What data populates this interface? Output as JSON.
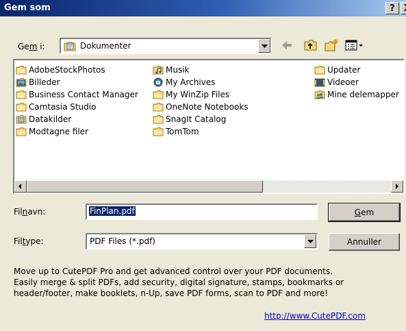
{
  "window": {
    "title": "Gem som",
    "help_label": "?",
    "close_label": "X"
  },
  "location": {
    "label_pre": "Ge",
    "label_accel": "m",
    "label_post": " i:",
    "value": "Dokumenter"
  },
  "files": [
    {
      "name": "AdobeStockPhotos",
      "icon": "folder-icon"
    },
    {
      "name": "Billeder",
      "icon": "pictures-folder-icon"
    },
    {
      "name": "Business Contact Manager",
      "icon": "folder-icon"
    },
    {
      "name": "Camtasia Studio",
      "icon": "folder-icon"
    },
    {
      "name": "Datakilder",
      "icon": "datasource-folder-icon"
    },
    {
      "name": "Modtagne filer",
      "icon": "folder-icon"
    },
    {
      "name": "Musik",
      "icon": "music-folder-icon"
    },
    {
      "name": "My Archives",
      "icon": "archive-icon"
    },
    {
      "name": "My WinZip Files",
      "icon": "folder-icon"
    },
    {
      "name": "OneNote Notebooks",
      "icon": "folder-icon"
    },
    {
      "name": "SnagIt Catalog",
      "icon": "folder-icon"
    },
    {
      "name": "TomTom",
      "icon": "folder-icon"
    },
    {
      "name": "Updater",
      "icon": "folder-icon"
    },
    {
      "name": "Videoer",
      "icon": "video-folder-icon"
    },
    {
      "name": "Mine delemapper",
      "icon": "shared-folder-icon"
    }
  ],
  "filename": {
    "label_pre": "Fil",
    "label_accel": "n",
    "label_post": "avn:",
    "value": "FinPlan.pdf"
  },
  "filetype": {
    "label_pre": "Fil",
    "label_accel": "t",
    "label_post": "ype:",
    "value": "PDF Files (*.pdf)"
  },
  "buttons": {
    "save_accel": "G",
    "save_rest": "em",
    "cancel": "Annuller"
  },
  "promo": {
    "lines": [
      "Move up to CutePDF Pro and get advanced control over your PDF documents.",
      "Easily merge & split PDFs, add security, digital signature, stamps, bookmarks or",
      "header/footer, make booklets, n-Up, save PDF forms, scan to PDF and more!"
    ],
    "link": "http://www.CutePDF.com"
  },
  "colors": {
    "title_bar": "#0a246a",
    "dialog_bg": "#ece9d8",
    "selection": "#0a246a",
    "link": "#0000cc"
  }
}
